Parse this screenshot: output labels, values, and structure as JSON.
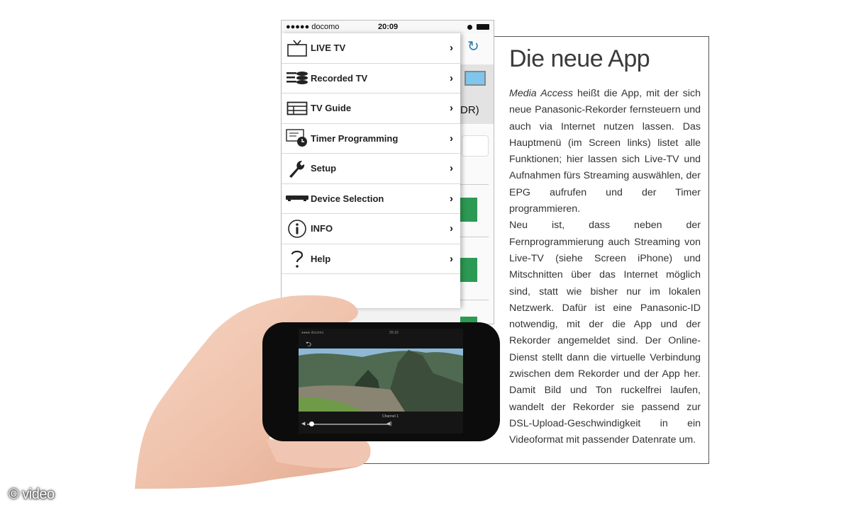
{
  "article": {
    "title": "Die neue App",
    "intro_italic": "Media Access",
    "body": " heißt die App, mit der sich neue Panasonic-Rekorder fernsteuern und auch via Internet nutzen lassen. Das Hauptmenü (im Screen links) listet alle Funktionen; hier lassen sich Live-TV und Aufnahmen fürs Streaming auswählen, der EPG aufrufen und der Timer programmieren.",
    "body2": "Neu ist, dass neben der Fernprogrammierung auch Streaming von Live-TV (siehe Screen iPhone) und Mitschnitten über das Internet möglich sind, statt wie bisher nur im lokalen Netzwerk. Dafür ist eine Panasonic-ID notwendig, mit der die App und der Rekorder angemeldet sind. Der Online-Dienst stellt dann die virtuelle Verbindung zwischen dem Rekorder und der App her. Damit Bild und Ton ruckelfrei laufen, wandelt der Rekorder sie passend zur DSL-Upload-Geschwindigkeit in ein Videoformat mit passender Datenrate um."
  },
  "iphone": {
    "status": {
      "carrier": "●●●●● docomo",
      "wifi": "wifi-icon",
      "time": "20:09"
    },
    "background_app": {
      "partial_text": "DR)",
      "refresh": "↻"
    },
    "menu": [
      {
        "label": "LIVE TV",
        "icon": "tv-icon"
      },
      {
        "label": "Recorded TV",
        "icon": "recordings-icon"
      },
      {
        "label": "TV Guide",
        "icon": "guide-grid-icon"
      },
      {
        "label": "Timer Programming",
        "icon": "timer-icon"
      },
      {
        "label": "Setup",
        "icon": "wrench-icon"
      },
      {
        "label": "Device Selection",
        "icon": "recorder-device-icon"
      },
      {
        "label": "INFO",
        "icon": "info-icon"
      },
      {
        "label": "Help",
        "icon": "help-icon"
      }
    ],
    "chevron": "›"
  },
  "phone_player": {
    "status": "●●●● docomo",
    "time": "20:10",
    "channel": "Channel 1",
    "back": "⮌",
    "volume_level": 0.05
  },
  "copyright": "© video"
}
